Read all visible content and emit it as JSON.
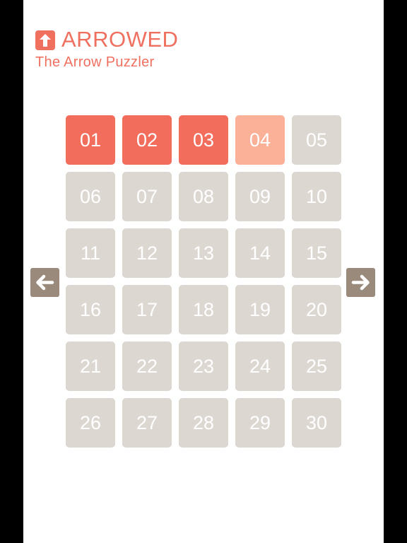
{
  "header": {
    "title": "ARROWED",
    "subtitle": "The Arrow Puzzler",
    "logo_icon": "up-arrow-icon"
  },
  "colors": {
    "accent": "#f07060",
    "tile_done": "#f36d5c",
    "tile_current": "#fbb098",
    "tile_locked": "#ddd7d2",
    "nav_button": "#9a8a7b"
  },
  "levels": [
    {
      "label": "01",
      "state": "done"
    },
    {
      "label": "02",
      "state": "done"
    },
    {
      "label": "03",
      "state": "done"
    },
    {
      "label": "04",
      "state": "current"
    },
    {
      "label": "05",
      "state": "locked"
    },
    {
      "label": "06",
      "state": "locked"
    },
    {
      "label": "07",
      "state": "locked"
    },
    {
      "label": "08",
      "state": "locked"
    },
    {
      "label": "09",
      "state": "locked"
    },
    {
      "label": "10",
      "state": "locked"
    },
    {
      "label": "11",
      "state": "locked"
    },
    {
      "label": "12",
      "state": "locked"
    },
    {
      "label": "13",
      "state": "locked"
    },
    {
      "label": "14",
      "state": "locked"
    },
    {
      "label": "15",
      "state": "locked"
    },
    {
      "label": "16",
      "state": "locked"
    },
    {
      "label": "17",
      "state": "locked"
    },
    {
      "label": "18",
      "state": "locked"
    },
    {
      "label": "19",
      "state": "locked"
    },
    {
      "label": "20",
      "state": "locked"
    },
    {
      "label": "21",
      "state": "locked"
    },
    {
      "label": "22",
      "state": "locked"
    },
    {
      "label": "23",
      "state": "locked"
    },
    {
      "label": "24",
      "state": "locked"
    },
    {
      "label": "25",
      "state": "locked"
    },
    {
      "label": "26",
      "state": "locked"
    },
    {
      "label": "27",
      "state": "locked"
    },
    {
      "label": "28",
      "state": "locked"
    },
    {
      "label": "29",
      "state": "locked"
    },
    {
      "label": "30",
      "state": "locked"
    }
  ],
  "navigation": {
    "prev_icon": "arrow-left-icon",
    "next_icon": "arrow-right-icon"
  }
}
